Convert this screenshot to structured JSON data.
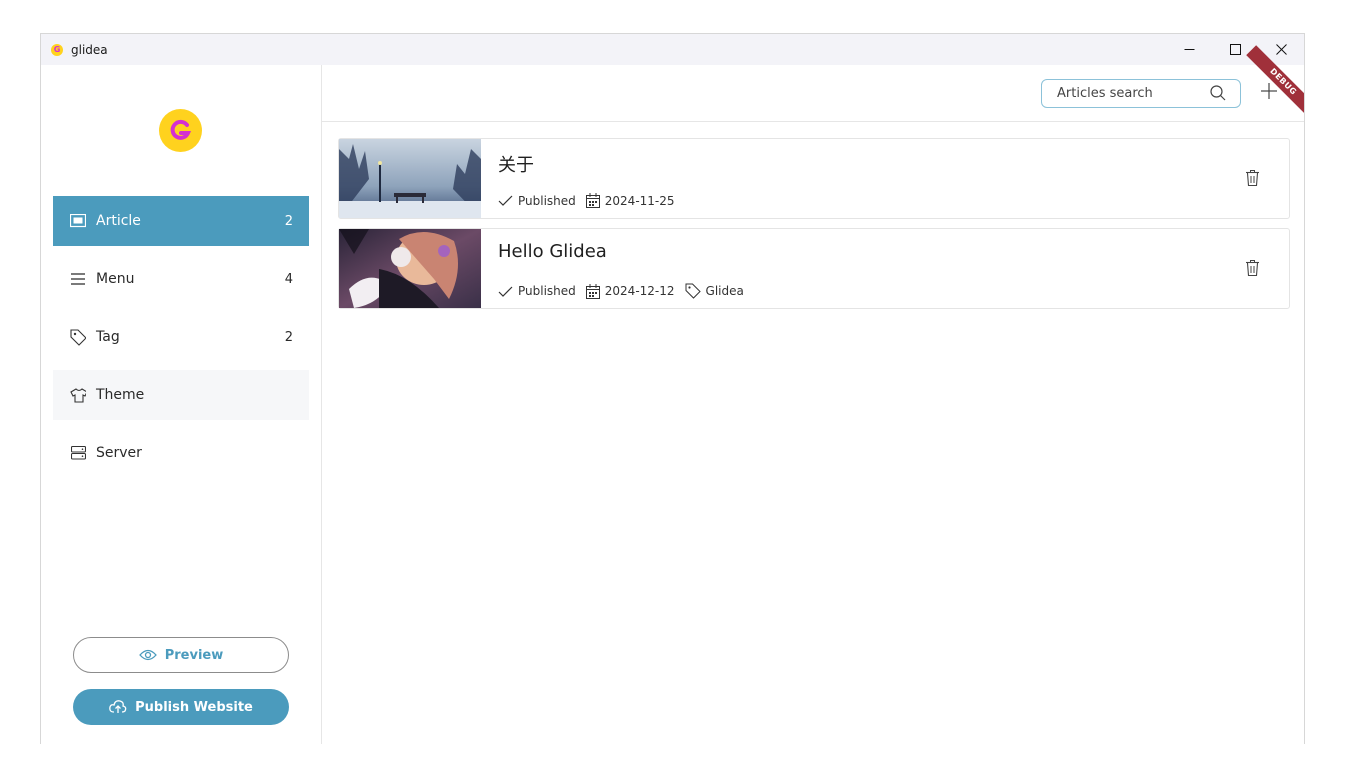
{
  "window": {
    "title": "glidea"
  },
  "sidebar": {
    "logo_letter": "G",
    "items": [
      {
        "label": "Article",
        "count": "2",
        "icon": "article-icon"
      },
      {
        "label": "Menu",
        "count": "4",
        "icon": "menu-icon"
      },
      {
        "label": "Tag",
        "count": "2",
        "icon": "tag-icon"
      },
      {
        "label": "Theme",
        "count": "",
        "icon": "shirt-icon"
      },
      {
        "label": "Server",
        "count": "",
        "icon": "server-icon"
      }
    ],
    "preview_label": "Preview",
    "publish_label": "Publish Website"
  },
  "main": {
    "search_placeholder": "Articles search",
    "debug_label": "DEBUG",
    "articles": [
      {
        "title": "关于",
        "status": "Published",
        "date": "2024-11-25",
        "tag": ""
      },
      {
        "title": "Hello Glidea",
        "status": "Published",
        "date": "2024-12-12",
        "tag": "Glidea"
      }
    ]
  },
  "colors": {
    "accent": "#4b9bbd",
    "logo_bg": "#ffd21e",
    "logo_fg": "#d42fd1",
    "debug": "#a0303a"
  }
}
